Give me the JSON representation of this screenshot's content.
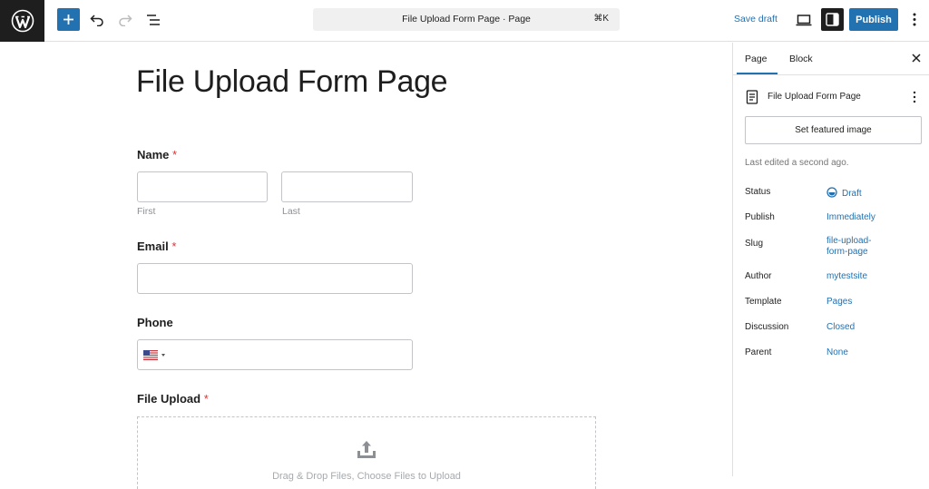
{
  "topbar": {
    "document_title": "File Upload Form Page · Page",
    "shortcut": "⌘K",
    "save_draft": "Save draft",
    "publish": "Publish",
    "icons": [
      "wordpress-logo",
      "plus-icon",
      "undo-icon",
      "redo-icon",
      "list-view-icon",
      "desktop-preview-icon",
      "sidebar-icon",
      "more-vertical-icon"
    ],
    "accent_color": "#2271b1"
  },
  "canvas": {
    "page_title": "File Upload Form Page",
    "fields": {
      "name": {
        "label": "Name",
        "required_mark": "*",
        "first_sublabel": "First",
        "last_sublabel": "Last"
      },
      "email": {
        "label": "Email",
        "required_mark": "*"
      },
      "phone": {
        "label": "Phone",
        "country_icon": "us-flag-icon"
      },
      "file_upload": {
        "label": "File Upload",
        "required_mark": "*",
        "dropzone_text": "Drag & Drop Files, Choose Files to Upload"
      }
    }
  },
  "sidebar": {
    "tabs": [
      {
        "label": "Page",
        "active": true
      },
      {
        "label": "Block",
        "active": false
      }
    ],
    "document": {
      "title": "File Upload Form Page"
    },
    "featured_image_button": "Set featured image",
    "last_edited": "Last edited a second ago.",
    "meta": {
      "status": {
        "label": "Status",
        "value": "Draft"
      },
      "publish": {
        "label": "Publish",
        "value": "Immediately"
      },
      "slug": {
        "label": "Slug",
        "value": "file-upload-form-page"
      },
      "author": {
        "label": "Author",
        "value": "mytestsite"
      },
      "template": {
        "label": "Template",
        "value": "Pages"
      },
      "discussion": {
        "label": "Discussion",
        "value": "Closed"
      },
      "parent": {
        "label": "Parent",
        "value": "None"
      }
    }
  }
}
